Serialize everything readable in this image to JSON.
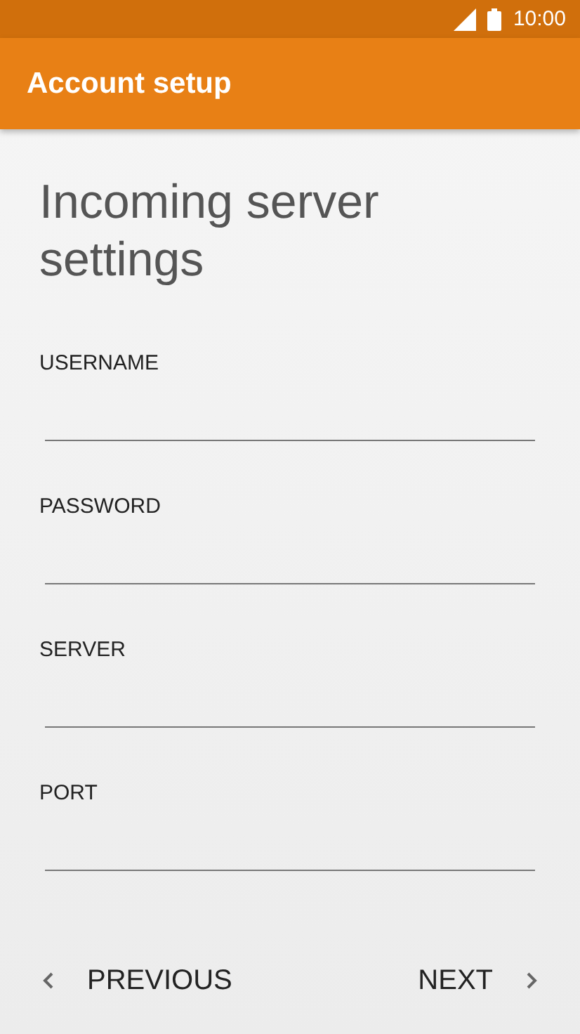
{
  "status_bar": {
    "time": "10:00"
  },
  "app_bar": {
    "title": "Account setup"
  },
  "heading": "Incoming server settings",
  "fields": [
    {
      "label": "USERNAME"
    },
    {
      "label": "PASSWORD"
    },
    {
      "label": "SERVER"
    },
    {
      "label": "PORT"
    }
  ],
  "nav": {
    "previous": "PREVIOUS",
    "next": "NEXT"
  }
}
